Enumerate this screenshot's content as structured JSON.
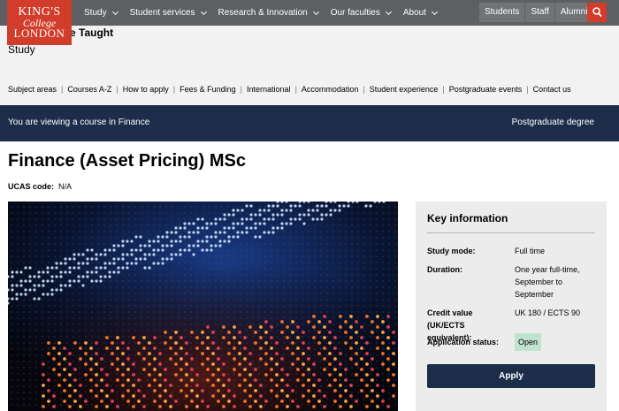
{
  "logo": {
    "line1": "KING'S",
    "line2": "College",
    "line3": "LONDON"
  },
  "nav": {
    "items": [
      {
        "label": "Study"
      },
      {
        "label": "Student services"
      },
      {
        "label": "Research & Innovation"
      },
      {
        "label": "Our faculties"
      },
      {
        "label": "About"
      }
    ],
    "utility": [
      {
        "label": "Students"
      },
      {
        "label": "Staff"
      },
      {
        "label": "Alumni"
      }
    ],
    "search_icon": "search-icon"
  },
  "section": {
    "title": "Postgraduate Taught",
    "subtitle": "Study",
    "subnav": [
      {
        "label": "Subject areas"
      },
      {
        "label": "Courses A-Z"
      },
      {
        "label": "How to apply"
      },
      {
        "label": "Fees & Funding"
      },
      {
        "label": "International"
      },
      {
        "label": "Accommodation"
      },
      {
        "label": "Student experience"
      },
      {
        "label": "Postgraduate events"
      },
      {
        "label": "Contact us"
      }
    ]
  },
  "banner": {
    "viewing": "You are viewing a course in Finance",
    "degree": "Postgraduate degree"
  },
  "course": {
    "title": "Finance (Asset Pricing) MSc",
    "ucas_label": "UCAS code:",
    "ucas_value": "N/A"
  },
  "key_info": {
    "title": "Key information",
    "study_mode_label": "Study mode:",
    "study_mode_value": "Full time",
    "duration_label": "Duration:",
    "duration_value": "One year full-time, September to September",
    "credit_label": "Credit value (UK/ECTS equivalent):",
    "credit_value": "UK 180 / ECTS 90",
    "status_label": "Application status:",
    "status_value": "Open",
    "apply_label": "Apply"
  },
  "colors": {
    "brand_red": "#d13d2a",
    "navy": "#1c2d4a",
    "topbar": "#5d5f63",
    "open_badge": "#bfe3cf"
  }
}
